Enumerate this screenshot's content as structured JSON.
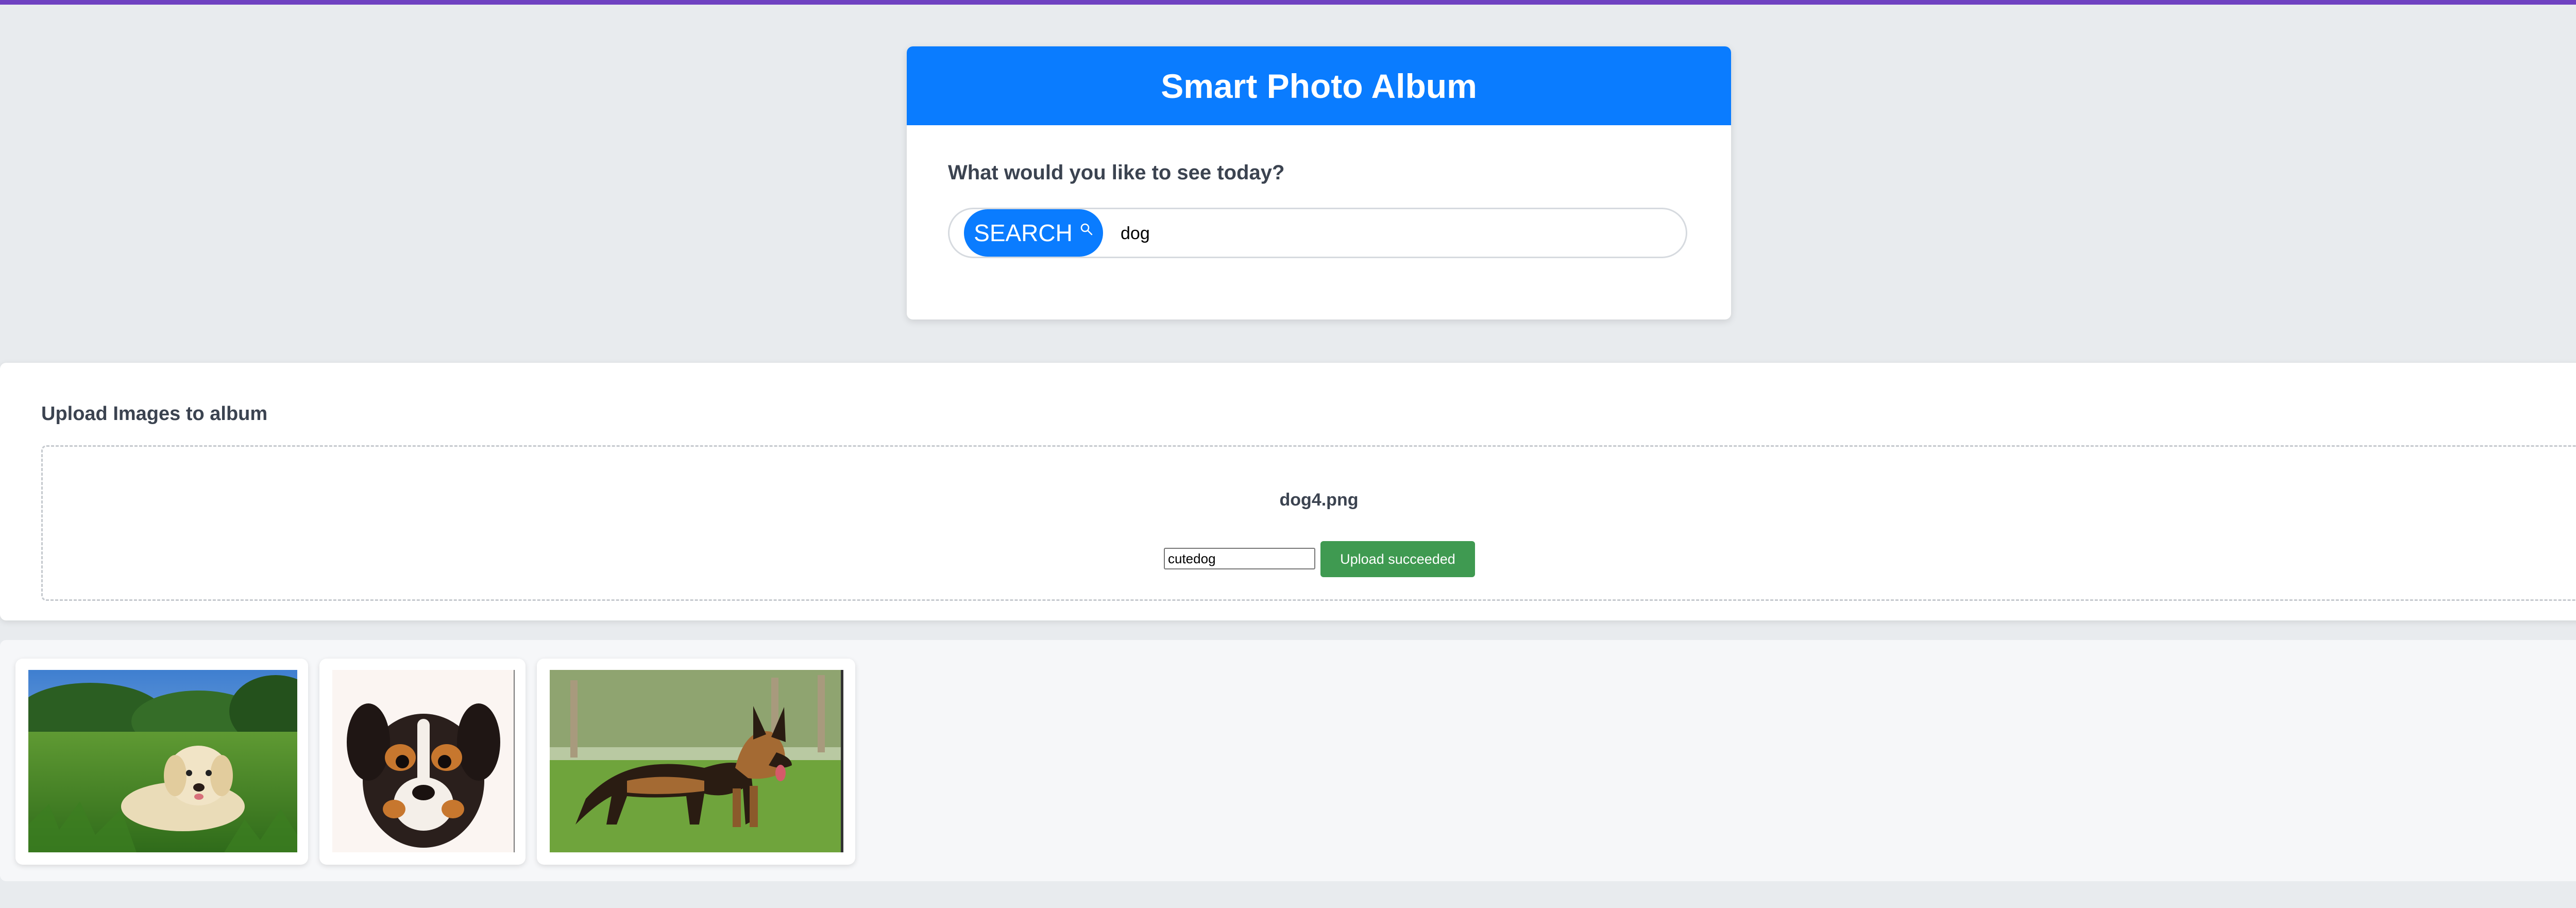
{
  "colors": {
    "accent": "#0a7cff",
    "top_bar": "#6f42c1",
    "success": "#3f9a51",
    "background": "#e8ebee"
  },
  "header": {
    "title": "Smart Photo Album"
  },
  "search": {
    "prompt": "What would you like to see today?",
    "button_label": "SEARCH",
    "button_icon": "search-icon",
    "query": "dog"
  },
  "upload": {
    "title": "Upload Images to album",
    "file_name": "dog4.png",
    "label_value": "cutedog",
    "status_button": "Upload succeeded"
  },
  "gallery": {
    "images": [
      {
        "subject": "golden-retriever-puppy"
      },
      {
        "subject": "tricolor-puppy"
      },
      {
        "subject": "german-shepherd"
      }
    ]
  }
}
